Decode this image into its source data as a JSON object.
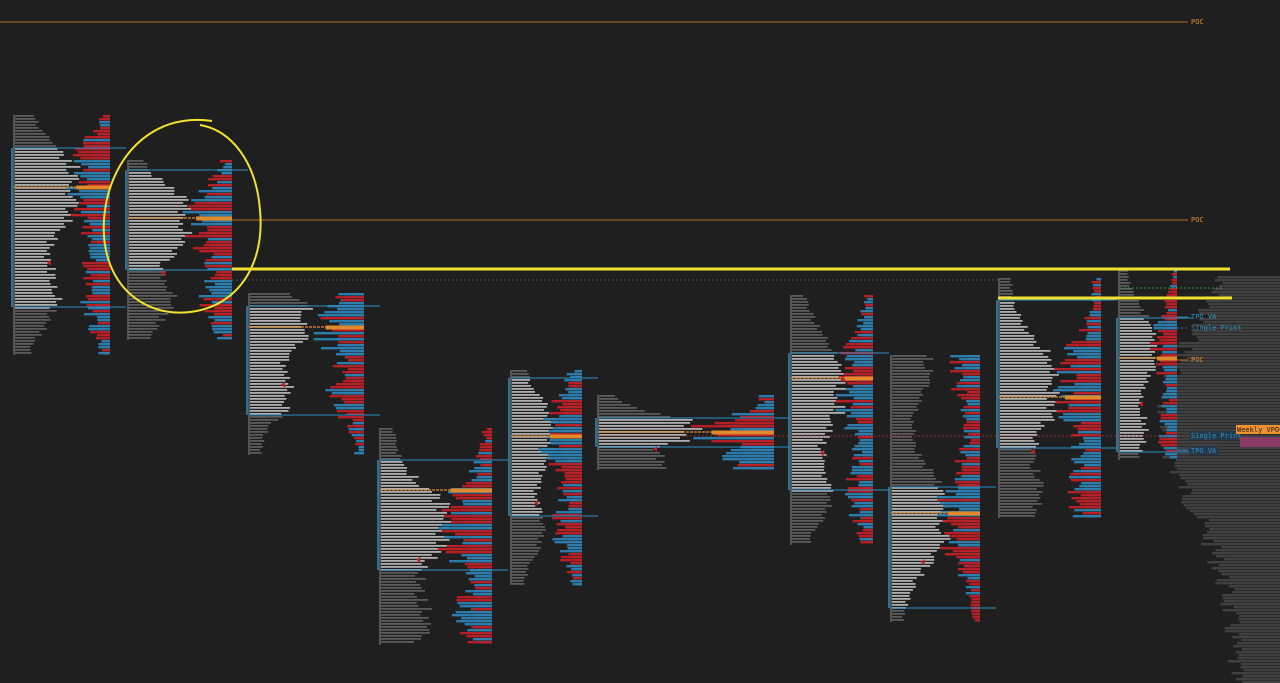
{
  "chart_data": {
    "type": "market-profile",
    "title": "",
    "xlabel": "",
    "ylabel": "",
    "annotations": [
      {
        "text": "POC",
        "color": "#e08a2c"
      },
      {
        "text": "POC",
        "color": "#e08a2c"
      },
      {
        "text": "TPO VA",
        "color": "#2b8fc4"
      },
      {
        "text": "Single Print",
        "color": "#2b8fc4"
      },
      {
        "text": "POC",
        "color": "#e08a2c"
      },
      {
        "text": "Single Print",
        "color": "#2b8fc4"
      },
      {
        "text": "TPO VA",
        "color": "#2b8fc4"
      },
      {
        "text": "Weekly VPOC",
        "color": "#f0922e"
      }
    ],
    "sessions": [
      {
        "high": 115,
        "low": 355,
        "poc": 187,
        "va_high": 148,
        "va_low": 307
      },
      {
        "high": 160,
        "low": 340,
        "poc": 218,
        "va_high": 170,
        "va_low": 270
      },
      {
        "high": 293,
        "low": 455,
        "poc": 327,
        "va_high": 306,
        "va_low": 415
      },
      {
        "high": 428,
        "low": 645,
        "poc": 490,
        "va_high": 460,
        "va_low": 570
      },
      {
        "high": 370,
        "low": 585,
        "poc": 436,
        "va_high": 378,
        "va_low": 516
      },
      {
        "high": 395,
        "low": 470,
        "poc": 432,
        "va_high": 418,
        "va_low": 447
      },
      {
        "high": 295,
        "low": 545,
        "poc": 378,
        "va_high": 353,
        "va_low": 490
      },
      {
        "high": 355,
        "low": 622,
        "poc": 513,
        "va_high": 487,
        "va_low": 608
      },
      {
        "high": 278,
        "low": 518,
        "poc": 397,
        "va_high": 300,
        "va_low": 448
      },
      {
        "high": 270,
        "low": 460,
        "poc": 358,
        "va_high": 318,
        "va_low": 452
      }
    ],
    "highlights": {
      "circle": {
        "color": "#f2e22e"
      },
      "lines_color": "#f2e22e"
    },
    "colors": {
      "background": "#1f1f1f",
      "tpo": "#c8c8c8",
      "poc": "#e08a2c",
      "va": "#2b8fc4",
      "sell": "#c01e26",
      "buy": "#2b7fb3",
      "volume": "#555555",
      "weekly_vpoc_bg": "#f0922e"
    }
  }
}
